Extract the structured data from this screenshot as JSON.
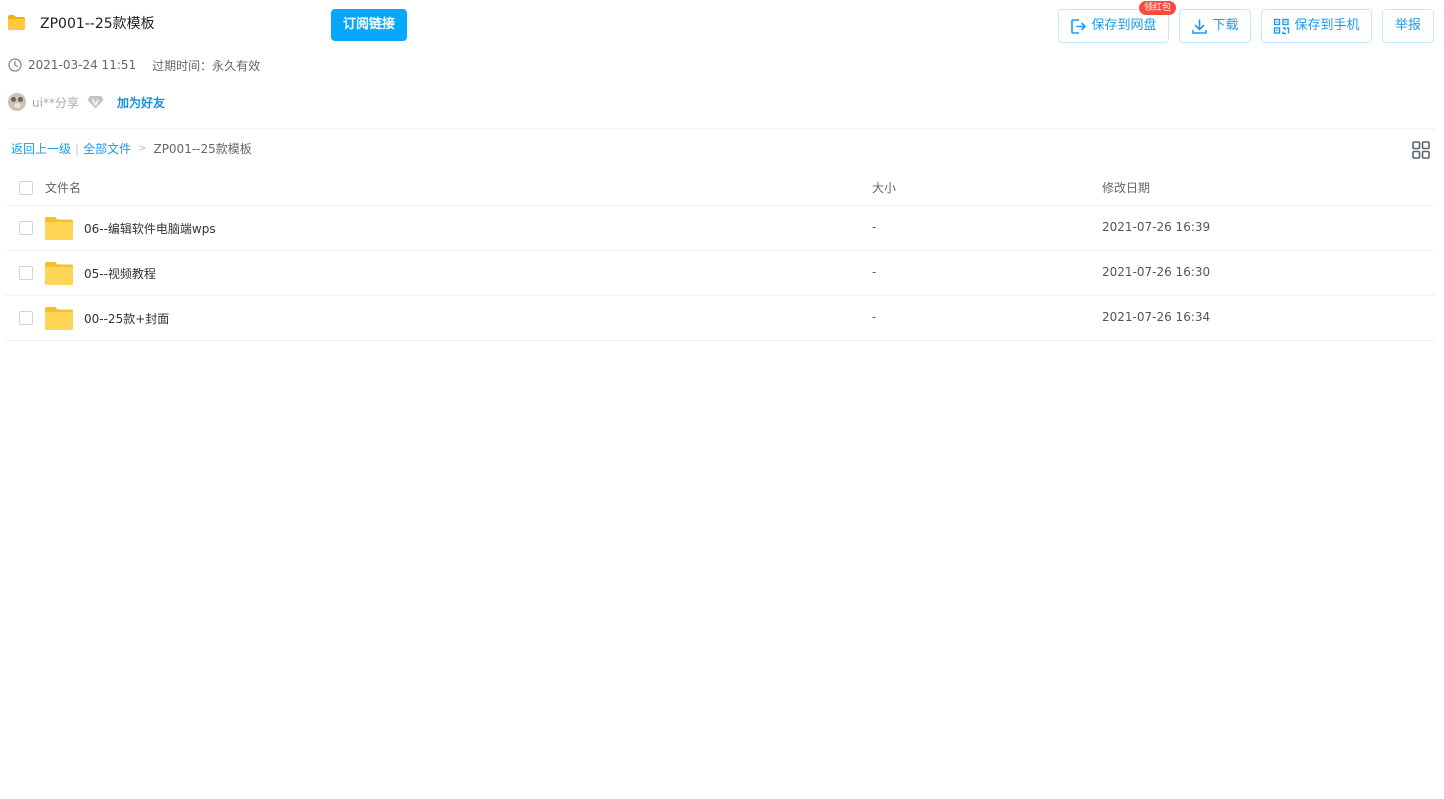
{
  "share": {
    "title": "ZP001--25款模板",
    "subscribe_label": "订阅链接",
    "created": "2021-03-24 11:51",
    "expire_text": "过期时间：永久有效"
  },
  "toolbar": {
    "save_netdisk_label": "保存到网盘",
    "red_packet_badge": "领红包",
    "download_label": "下载",
    "save_phone_label": "保存到手机",
    "report_label": "举报"
  },
  "user": {
    "name": "ui**分享",
    "add_friend_label": "加为好友"
  },
  "breadcrumb": {
    "back_label": "返回上一级",
    "separator": "|",
    "all_files_label": "全部文件",
    "arrow": ">",
    "current": "ZP001--25款模板"
  },
  "table": {
    "headers": {
      "name": "文件名",
      "size": "大小",
      "modified": "修改日期"
    },
    "rows": [
      {
        "name": "06--编辑软件电脑端wps",
        "size": "-",
        "modified": "2021-07-26 16:39"
      },
      {
        "name": "05--视频教程",
        "size": "-",
        "modified": "2021-07-26 16:30"
      },
      {
        "name": "00--25款+封面",
        "size": "-",
        "modified": "2021-07-26 16:34"
      }
    ]
  },
  "colors": {
    "accent": "#06a7ff",
    "link": "#1a9bf0",
    "badge": "#fa4b3e",
    "folder": "#ffd555"
  },
  "icons": [
    "folder-icon",
    "clock-icon",
    "vip-diamond-icon",
    "save-netdisk-icon",
    "download-icon",
    "qr-phone-icon",
    "grid-view-icon"
  ]
}
